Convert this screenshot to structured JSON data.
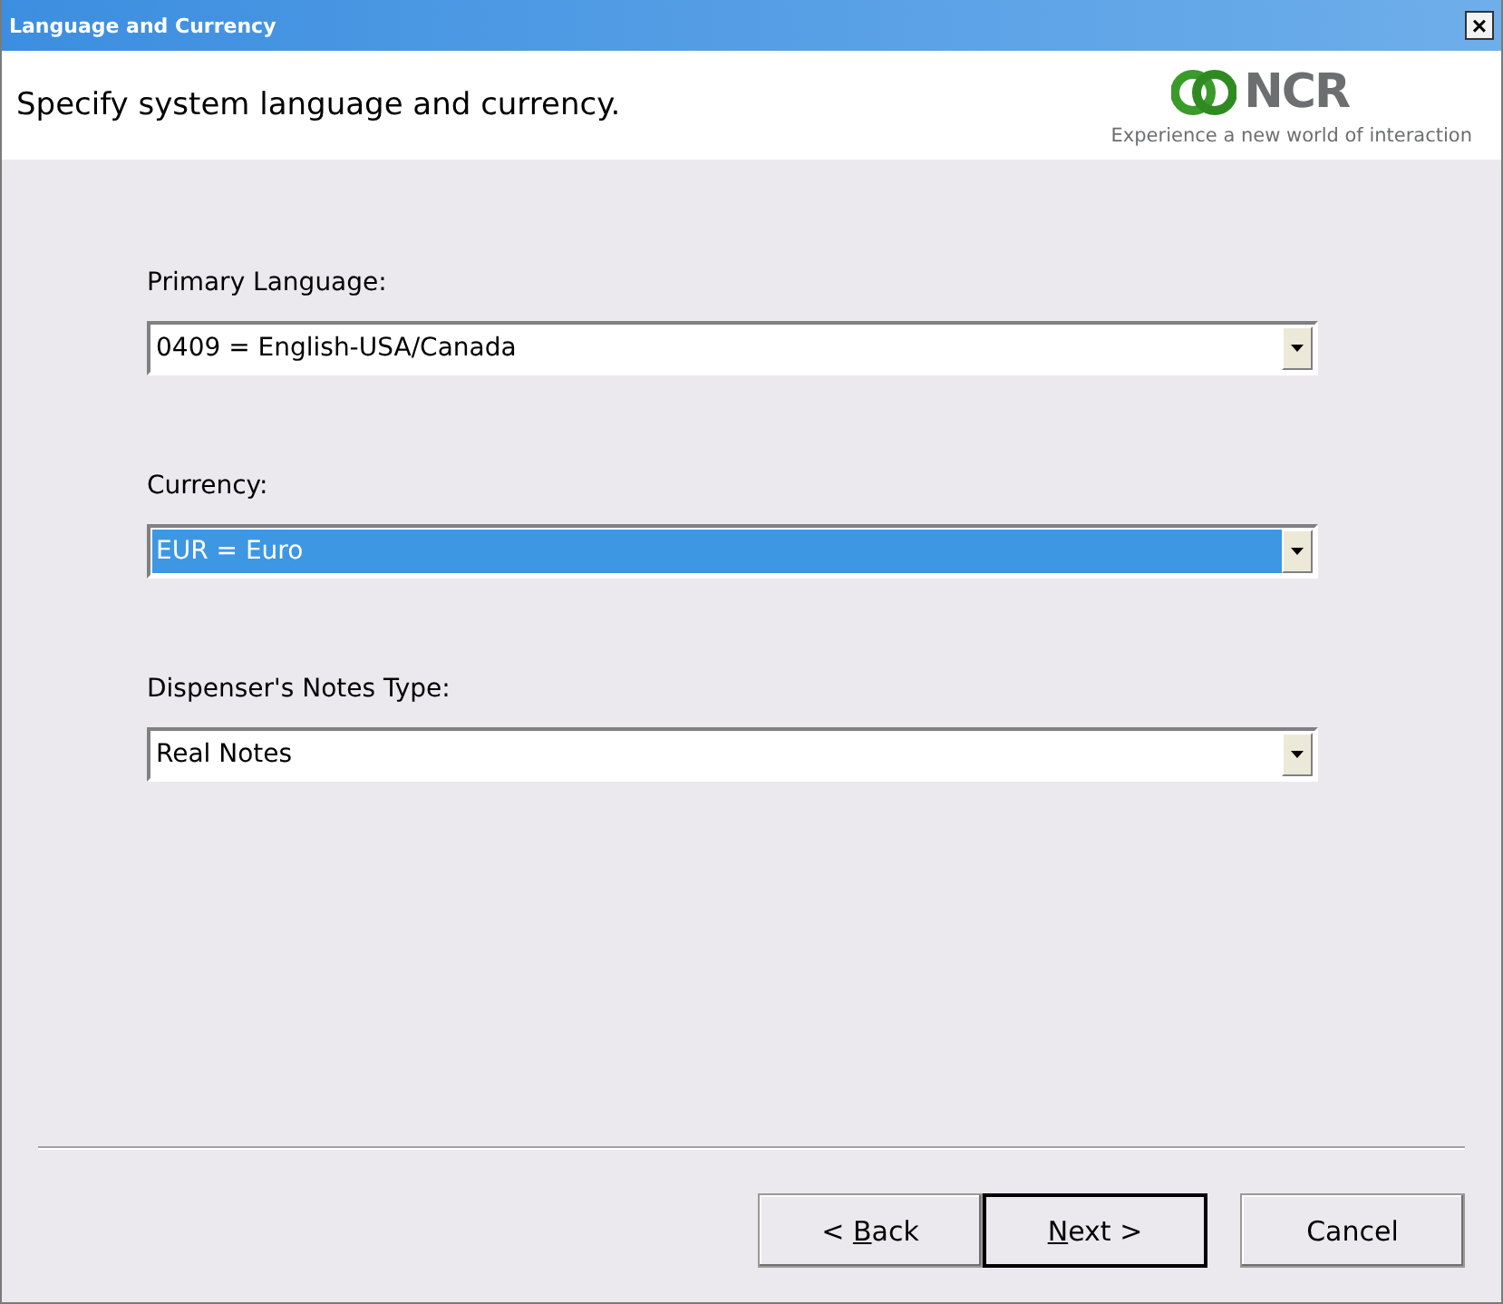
{
  "window": {
    "title": "Language and Currency",
    "close": "×"
  },
  "header": {
    "instruction": "Specify system language and currency.",
    "logo": {
      "name": "NCR",
      "tagline": "Experience a new world of interaction"
    }
  },
  "fields": [
    {
      "label": "Primary Language:",
      "value": "0409 = English-USA/Canada",
      "focused": false
    },
    {
      "label": "Currency:",
      "value": "EUR = Euro",
      "focused": true
    },
    {
      "label": "Dispenser's Notes Type:",
      "value": "Real Notes",
      "focused": false
    }
  ],
  "buttons": [
    {
      "prefix": "< ",
      "key": "B",
      "rest": "ack",
      "default": false
    },
    {
      "key": "N",
      "rest": "ext >",
      "default": true
    },
    {
      "rest": "Cancel",
      "default": false
    }
  ]
}
